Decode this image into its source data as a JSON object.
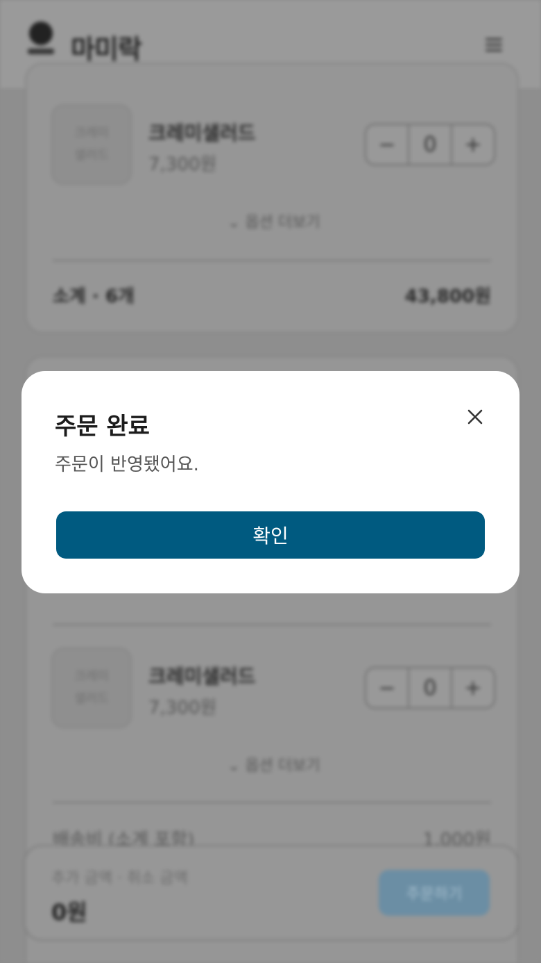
{
  "header": {
    "logo_text": "마미락",
    "menu_icon": "hamburger-icon"
  },
  "cards": [
    {
      "item": {
        "thumb_text": [
          "크레미",
          "샐러드"
        ],
        "name": "크레미샐러드",
        "price": "7,300원"
      },
      "stepper": {
        "minus": "−",
        "qty": "0",
        "plus": "+"
      },
      "options_label": "옵션 더보기",
      "subtotal_label": "소계 · 6개",
      "subtotal_value": "43,800원"
    },
    {
      "item": {
        "thumb_text": [
          "크레미",
          "샐러드"
        ],
        "name": "크레미샐러드",
        "price": "7,300원"
      },
      "stepper": {
        "minus": "−",
        "qty": "0",
        "plus": "+"
      },
      "options_label": "옵션 더보기",
      "fee_label": "배송비 (소계 포함)",
      "fee_value": "1,000원"
    }
  ],
  "bottom_bar": {
    "label": "추가 금액 · 취소 금액",
    "value": "0원",
    "button": "주문하기"
  },
  "modal": {
    "title": "주문 완료",
    "message": "주문이 반영됐어요.",
    "confirm": "확인",
    "close_icon": "close-icon"
  },
  "colors": {
    "primary": "#005a80",
    "overlay": "#8c8c8c"
  }
}
